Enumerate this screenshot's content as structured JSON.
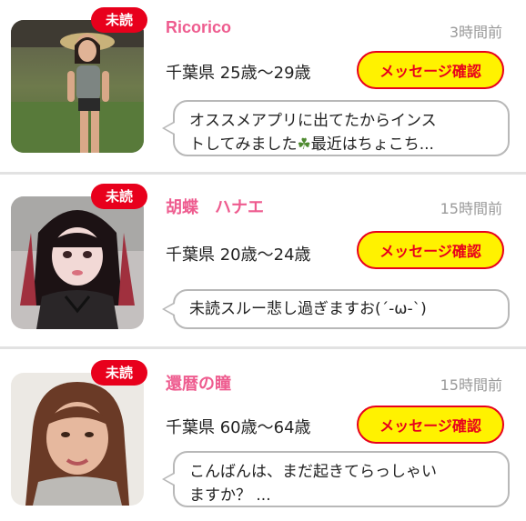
{
  "colors": {
    "name": "#ee5c8f",
    "badge": "#e8001c",
    "button_bg": "#fff200",
    "button_text": "#e8001c",
    "time": "#9a9a9a"
  },
  "cards": [
    {
      "badge": "未読",
      "name": "Ricorico",
      "time": "3時間前",
      "location_age": "千葉県 25歳〜29歳",
      "button": "メッセージ確認",
      "message_line1": "オススメアプリに出てたからインス",
      "message_line2_a": "トしてみました",
      "message_icon": "clover-icon",
      "message_line2_b": "最近はちょこち..."
    },
    {
      "badge": "未読",
      "name": "胡蝶　ハナエ",
      "time": "15時間前",
      "location_age": "千葉県 20歳〜24歳",
      "button": "メッセージ確認",
      "message_line1": "未読スルー悲し過ぎますお(´-ω-`)"
    },
    {
      "badge": "未読",
      "name": "還暦の瞳",
      "time": "15時間前",
      "location_age": "千葉県 60歳〜64歳",
      "button": "メッセージ確認",
      "message_line1": "こんばんは、まだ起きてらっしゃい",
      "message_line2": "ますか？ ..."
    }
  ]
}
